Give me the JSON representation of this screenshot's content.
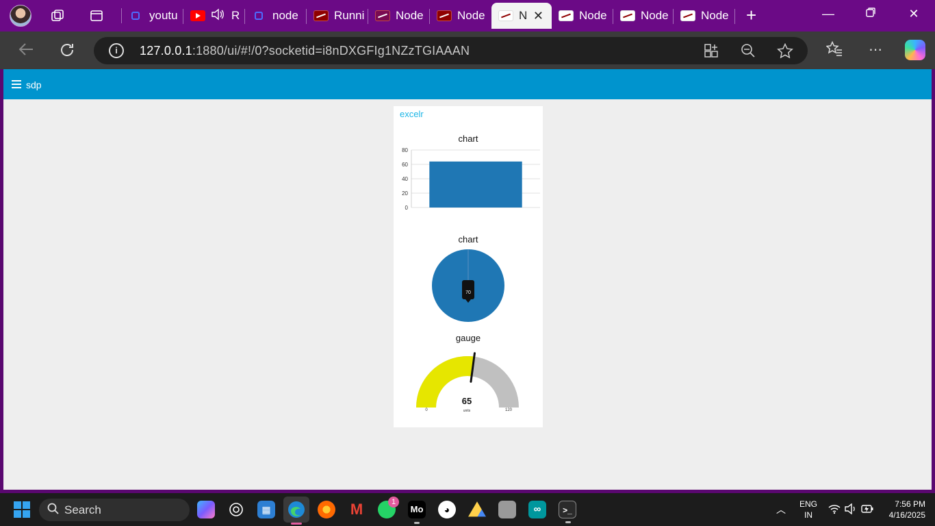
{
  "browser": {
    "tabs": [
      {
        "label": "youtu",
        "icon": "search-icon"
      },
      {
        "label": "R",
        "icon": "youtube-icon"
      },
      {
        "label": "node",
        "icon": "search-icon"
      },
      {
        "label": "Runni",
        "icon": "node-red-icon"
      },
      {
        "label": "Node",
        "icon": "node-red-icon"
      },
      {
        "label": "Node",
        "icon": "node-red-icon"
      },
      {
        "label": "N",
        "icon": "node-red-icon",
        "active": true
      },
      {
        "label": "Node",
        "icon": "node-red-icon"
      },
      {
        "label": "Node",
        "icon": "node-red-icon"
      },
      {
        "label": "Node",
        "icon": "node-red-icon"
      }
    ],
    "address": {
      "host": "127.0.0.1",
      "rest": ":1880/ui/#!/0?socketid=i8nDXGFIg1NZzTGIAAAN"
    }
  },
  "app": {
    "title": "sdp",
    "header_color": "#0094ce"
  },
  "group": {
    "title": "excelr",
    "bar_chart": {
      "title": "chart"
    },
    "pie_chart": {
      "title": "chart"
    },
    "gauge": {
      "title": "gauge",
      "value": "65",
      "units": "units",
      "min": "0",
      "max": "120",
      "value_num": 65,
      "min_num": 0,
      "max_num": 120,
      "fill_color": "#e6e600",
      "track_color": "#c0c0c0"
    }
  },
  "chart_data": [
    {
      "type": "bar",
      "title": "chart",
      "categories": [
        ""
      ],
      "values": [
        64
      ],
      "ylim": [
        0,
        80
      ],
      "yticks": [
        "0",
        "20",
        "40",
        "60",
        "80"
      ],
      "color": "#1f77b4",
      "grid": true
    },
    {
      "type": "pie",
      "title": "chart",
      "values": [
        70
      ],
      "data_labels": [
        "70"
      ],
      "color": "#1f77b4"
    }
  ],
  "taskbar": {
    "search_label": "Search",
    "whatsapp_badge": "1",
    "language": "ENG",
    "region": "IN",
    "time": "7:56 PM",
    "date": "4/16/2025"
  }
}
